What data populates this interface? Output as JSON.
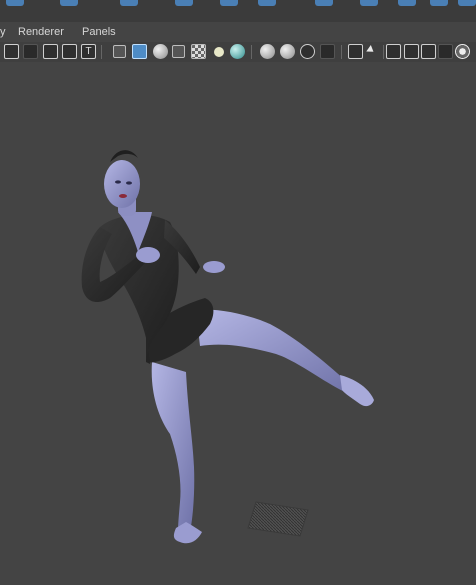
{
  "menubar": {
    "edge_label": "y",
    "renderer": "Renderer",
    "panels": "Panels"
  },
  "toolbar": {
    "icons": [
      "select-camera-icon",
      "lock-camera-icon",
      "grid-icon",
      "film-gate-icon",
      "text-icon",
      "wireframe-cube-icon",
      "smooth-shade-cube-icon",
      "shade-half-icon",
      "textured-cube-icon",
      "checker-texture-icon",
      "light-bulb-icon",
      "lighting-teal-icon",
      "shadow-ball-icon",
      "ambient-occlusion-ball-icon",
      "motion-blur-icon",
      "anti-alias-icon",
      "isolate-select-icon",
      "xray-icon",
      "xray-joints-icon",
      "xray-active-icon",
      "gear-icon"
    ]
  },
  "viewport": {
    "background_color": "#444444",
    "subject": "posed-3d-character"
  },
  "colors": {
    "viewport_bg": "#444444",
    "toolbar_bg": "#3f3f3f",
    "accent_blue": "#5e97c9",
    "skin": "#8f90c6",
    "outfit": "#2b2b2b"
  }
}
